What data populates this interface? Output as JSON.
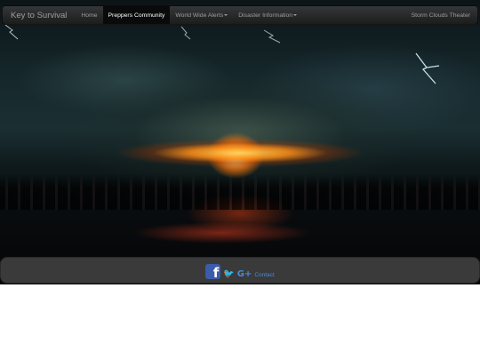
{
  "navbar": {
    "brand": "Key to Survival",
    "items": [
      {
        "label": "Home",
        "active": false
      },
      {
        "label": "Preppers Community",
        "active": true
      },
      {
        "label": "World Wide Alerts",
        "active": false,
        "dropdown": true
      },
      {
        "label": "Disaster Information",
        "active": false,
        "dropdown": true
      }
    ],
    "right_link": "Storm Clouds Theater"
  },
  "footer": {
    "icons": [
      "facebook-icon",
      "twitter-icon",
      "google-plus-icon"
    ],
    "facebook_glyph": "f",
    "twitter_glyph": "🐦",
    "googleplus_glyph": "G+",
    "contact_label": "Contact",
    "link_color": "#4a8ad4",
    "facebook_color": "#3b5ca8"
  }
}
